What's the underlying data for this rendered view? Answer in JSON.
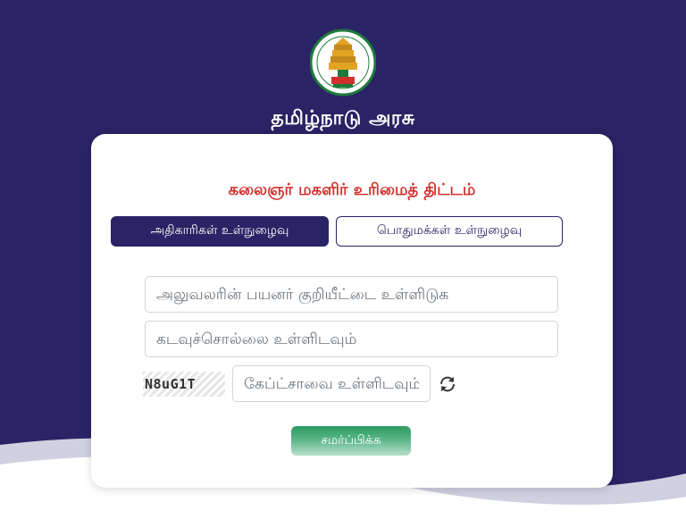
{
  "header": {
    "government_title": "தமிழ்நாடு அரசு"
  },
  "card": {
    "scheme_title": "கலைஞர் மகளிர் உரிமைத் திட்டம்",
    "tabs": [
      {
        "label": "அதிகாரிகள் உள்நுழைவு",
        "active": true
      },
      {
        "label": "பொதுமக்கள் உள்நுழைவு",
        "active": false
      }
    ],
    "fields": {
      "user_id_placeholder": "அலுவலரின் பயனர் குறியீட்டை உள்ளிடுக",
      "password_placeholder": "கடவுச்சொல்லை உள்ளிடவும்",
      "captcha_placeholder": "கேப்ட்சாவை உள்ளிடவும்"
    },
    "captcha_code": "N8uG1T",
    "submit_label": "சமர்ப்பிக்க"
  },
  "colors": {
    "brand_navy": "#2a2365",
    "title_red": "#d0312d",
    "submit_green": "#2e9b62"
  },
  "icons": {
    "emblem": "tamilnadu-emblem-icon",
    "refresh": "refresh-icon"
  }
}
